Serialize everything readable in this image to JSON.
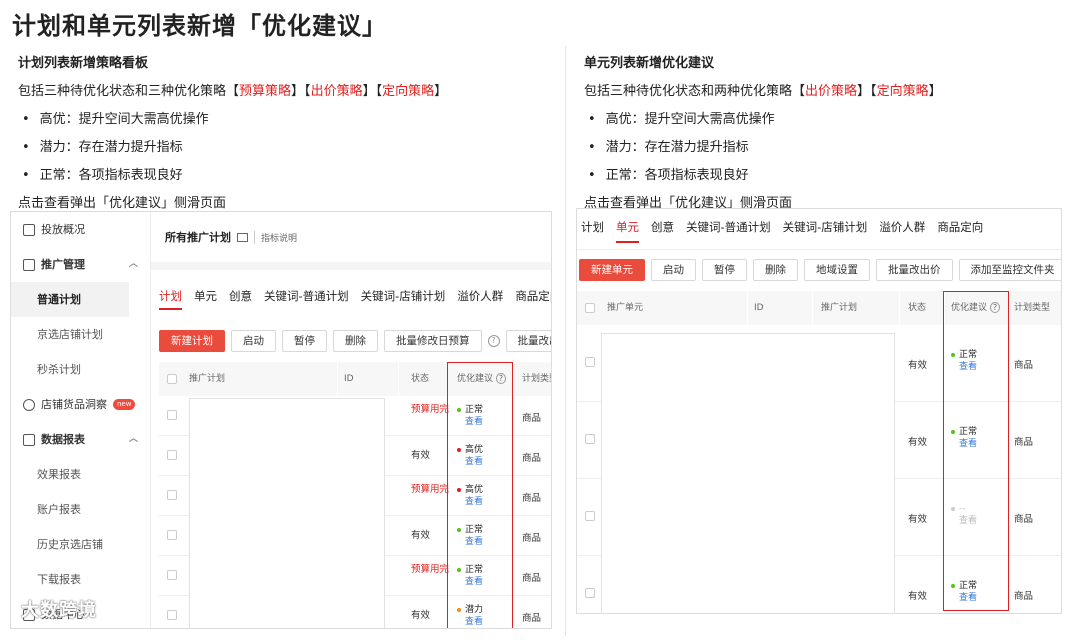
{
  "title": "计划和单元列表新增「优化建议」",
  "left": {
    "heading": "计划列表新增策略看板",
    "desc_prefix": "包括三种待优化状态和三种优化策略",
    "tags": [
      "【",
      "预算策略",
      "】【",
      "出价策略",
      "】【",
      "定向策略",
      "】"
    ],
    "bullets": [
      "高优：提升空间大需高优操作",
      "潜力：存在潜力提升指标",
      "正常：各项指标表现良好"
    ],
    "note": "点击查看弹出「优化建议」侧滑页面"
  },
  "right": {
    "heading": "单元列表新增优化建议",
    "desc_prefix": "包括三种待优化状态和两种优化策略",
    "tags": [
      "【",
      "出价策略",
      "】【",
      "定向策略",
      "】"
    ],
    "bullets": [
      "高优：提升空间大需高优操作",
      "潜力：存在潜力提升指标",
      "正常：各项指标表现良好"
    ],
    "note": "点击查看弹出「优化建议」侧滑页面"
  },
  "left_shot": {
    "sidebar": {
      "overview": "投放概况",
      "promo_mgmt": "推广管理",
      "promo_items": [
        "普通计划",
        "京选店铺计划",
        "秒杀计划"
      ],
      "insight": "店铺货品洞察",
      "new_badge": "new",
      "reports": "数据报表",
      "report_items": [
        "效果报表",
        "账户报表",
        "历史京选店铺",
        "下载报表"
      ],
      "data_center": "数据中心"
    },
    "topbar": {
      "title": "所有推广计划",
      "tip": "指标说明"
    },
    "tabs": [
      "计划",
      "单元",
      "创意",
      "关键词-普通计划",
      "关键词-店铺计划",
      "溢价人群",
      "商品定向"
    ],
    "buttons": [
      "新建计划",
      "启动",
      "暂停",
      "删除",
      "批量修改日预算",
      "批量改出价"
    ],
    "help": "?",
    "columns": {
      "plan": "推广计划",
      "id": "ID",
      "status": "状态",
      "suggest": "优化建议",
      "type": "计划类型"
    },
    "rows": [
      {
        "status": "预算用完",
        "status_red": true,
        "level": "正常",
        "color": "#52c41a",
        "view": "查看",
        "type": "商品"
      },
      {
        "status": "有效",
        "status_red": false,
        "level": "高优",
        "color": "#e02020",
        "view": "查看",
        "type": "商品"
      },
      {
        "status": "预算用完",
        "status_red": true,
        "level": "高优",
        "color": "#e02020",
        "view": "查看",
        "type": "商品"
      },
      {
        "status": "有效",
        "status_red": false,
        "level": "正常",
        "color": "#52c41a",
        "view": "查看",
        "type": "商品"
      },
      {
        "status": "预算用完",
        "status_red": true,
        "level": "正常",
        "color": "#52c41a",
        "view": "查看",
        "type": "商品"
      },
      {
        "status": "有效",
        "status_red": false,
        "level": "潜力",
        "color": "#fa8c16",
        "view": "查看",
        "type": "商品"
      }
    ]
  },
  "right_shot": {
    "tabs": [
      "计划",
      "单元",
      "创意",
      "关键词-普通计划",
      "关键词-店铺计划",
      "溢价人群",
      "商品定向"
    ],
    "buttons": [
      "新建单元",
      "启动",
      "暂停",
      "删除",
      "地域设置",
      "批量改出价",
      "添加至监控文件夹"
    ],
    "columns": {
      "unit": "推广单元",
      "id": "ID",
      "plan": "推广计划",
      "status": "状态",
      "suggest": "优化建议",
      "type": "计划类型"
    },
    "rows": [
      {
        "status": "有效",
        "level": "正常",
        "color": "#52c41a",
        "view": "查看",
        "type": "商品",
        "muted": false
      },
      {
        "status": "有效",
        "level": "正常",
        "color": "#52c41a",
        "view": "查看",
        "type": "商品",
        "muted": false
      },
      {
        "status": "有效",
        "level": "--",
        "color": "#cccccc",
        "view": "查看",
        "type": "商品",
        "muted": true
      },
      {
        "status": "有效",
        "level": "正常",
        "color": "#52c41a",
        "view": "查看",
        "type": "商品",
        "muted": false
      }
    ]
  },
  "watermark": "大数跨境"
}
